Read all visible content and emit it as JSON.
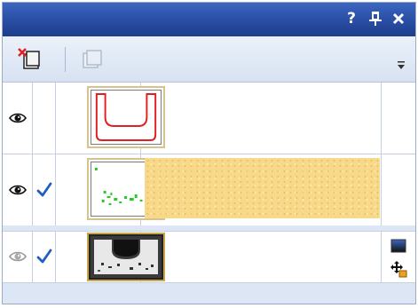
{
  "title_bar": {
    "help_label": "?",
    "pin_label": "Ԃ",
    "close_label": "×"
  },
  "toolbar": {
    "icons": [
      "new-layer-icon",
      "duplicate-layer-icon",
      "more-options-icon"
    ]
  },
  "layers": [
    {
      "icon": "eye-icon",
      "visible": true,
      "checked": false,
      "thumbnail": "red-u-outline",
      "has_fill_swatch": false
    },
    {
      "icon": "eye-icon",
      "visible": true,
      "checked": true,
      "thumbnail": "green-speckles",
      "has_fill_swatch": true
    },
    {
      "icon": "eye-icon",
      "visible": false,
      "checked": true,
      "thumbnail": "grayscale-image",
      "has_fill_swatch": false
    }
  ],
  "colors": {
    "title_bar": "#2b51a8",
    "panel_background": "#dde6f4",
    "check": "#1c5fc0",
    "sand_fill": "#f8d98a",
    "outline_red": "#e02020",
    "speckle_green": "#22cc22"
  }
}
